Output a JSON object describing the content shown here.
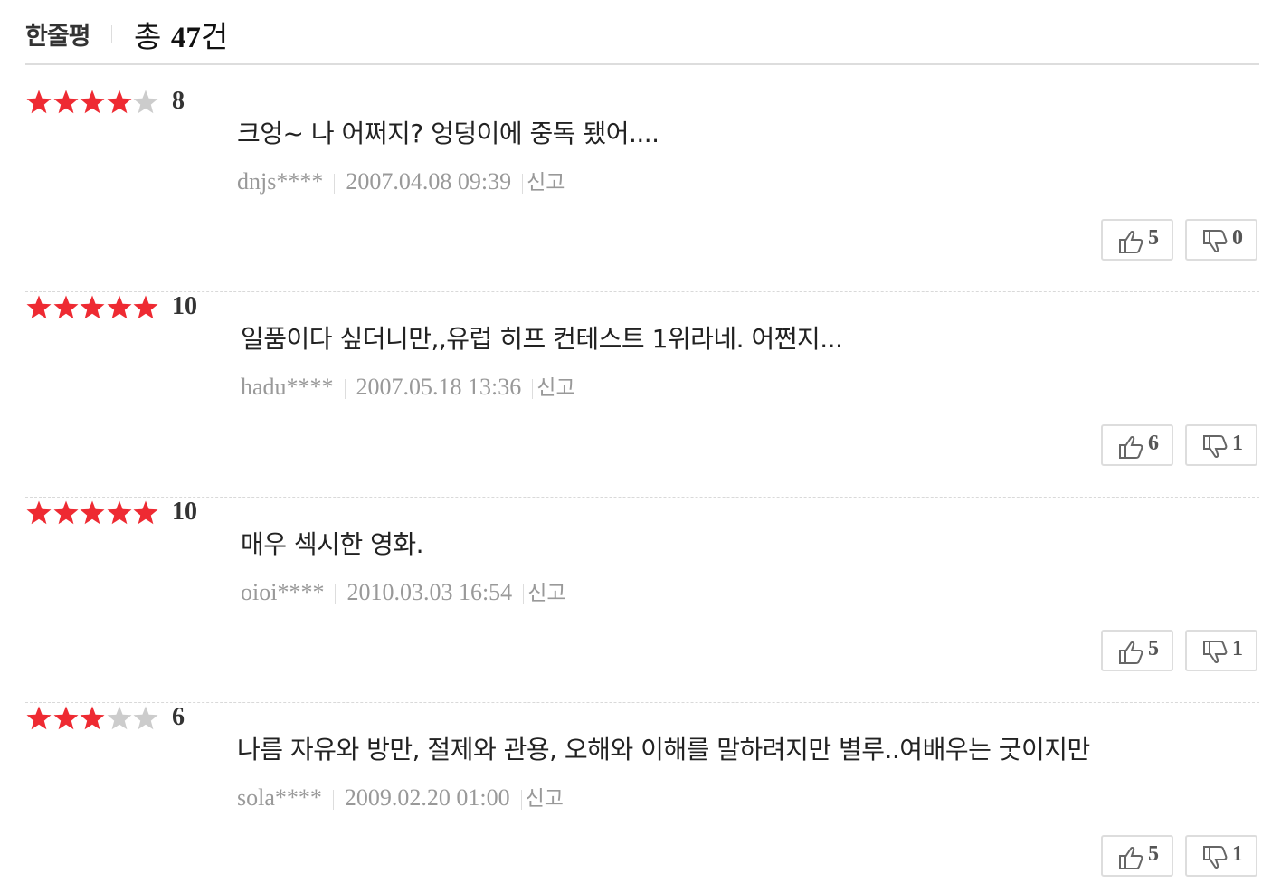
{
  "header": {
    "title": "한줄평",
    "total_label": "총",
    "total_count": "47",
    "total_unit": "건"
  },
  "colors": {
    "star_on": "#ee2a32",
    "star_off": "#cccccc"
  },
  "reviews": [
    {
      "rating": 4,
      "score": "8",
      "text": "크엉~ 나 어쩌지? 엉덩이에 중독 됐어....",
      "user": "dnjs****",
      "date": "2007.04.08 09:39",
      "report": "신고",
      "likes": "5",
      "dislikes": "0"
    },
    {
      "rating": 5,
      "score": "10",
      "text": "일품이다 싶더니만,,유럽 히프 컨테스트 1위라네. 어쩐지...",
      "user": "hadu****",
      "date": "2007.05.18 13:36",
      "report": "신고",
      "likes": "6",
      "dislikes": "1"
    },
    {
      "rating": 5,
      "score": "10",
      "text": "매우 섹시한 영화.",
      "user": "oioi****",
      "date": "2010.03.03 16:54",
      "report": "신고",
      "likes": "5",
      "dislikes": "1"
    },
    {
      "rating": 3,
      "score": "6",
      "text": "나름 자유와 방만, 절제와 관용, 오해와 이해를 말하려지만 별루..여배우는 굿이지만",
      "user": "sola****",
      "date": "2009.02.20 01:00",
      "report": "신고",
      "likes": "5",
      "dislikes": "1"
    }
  ]
}
